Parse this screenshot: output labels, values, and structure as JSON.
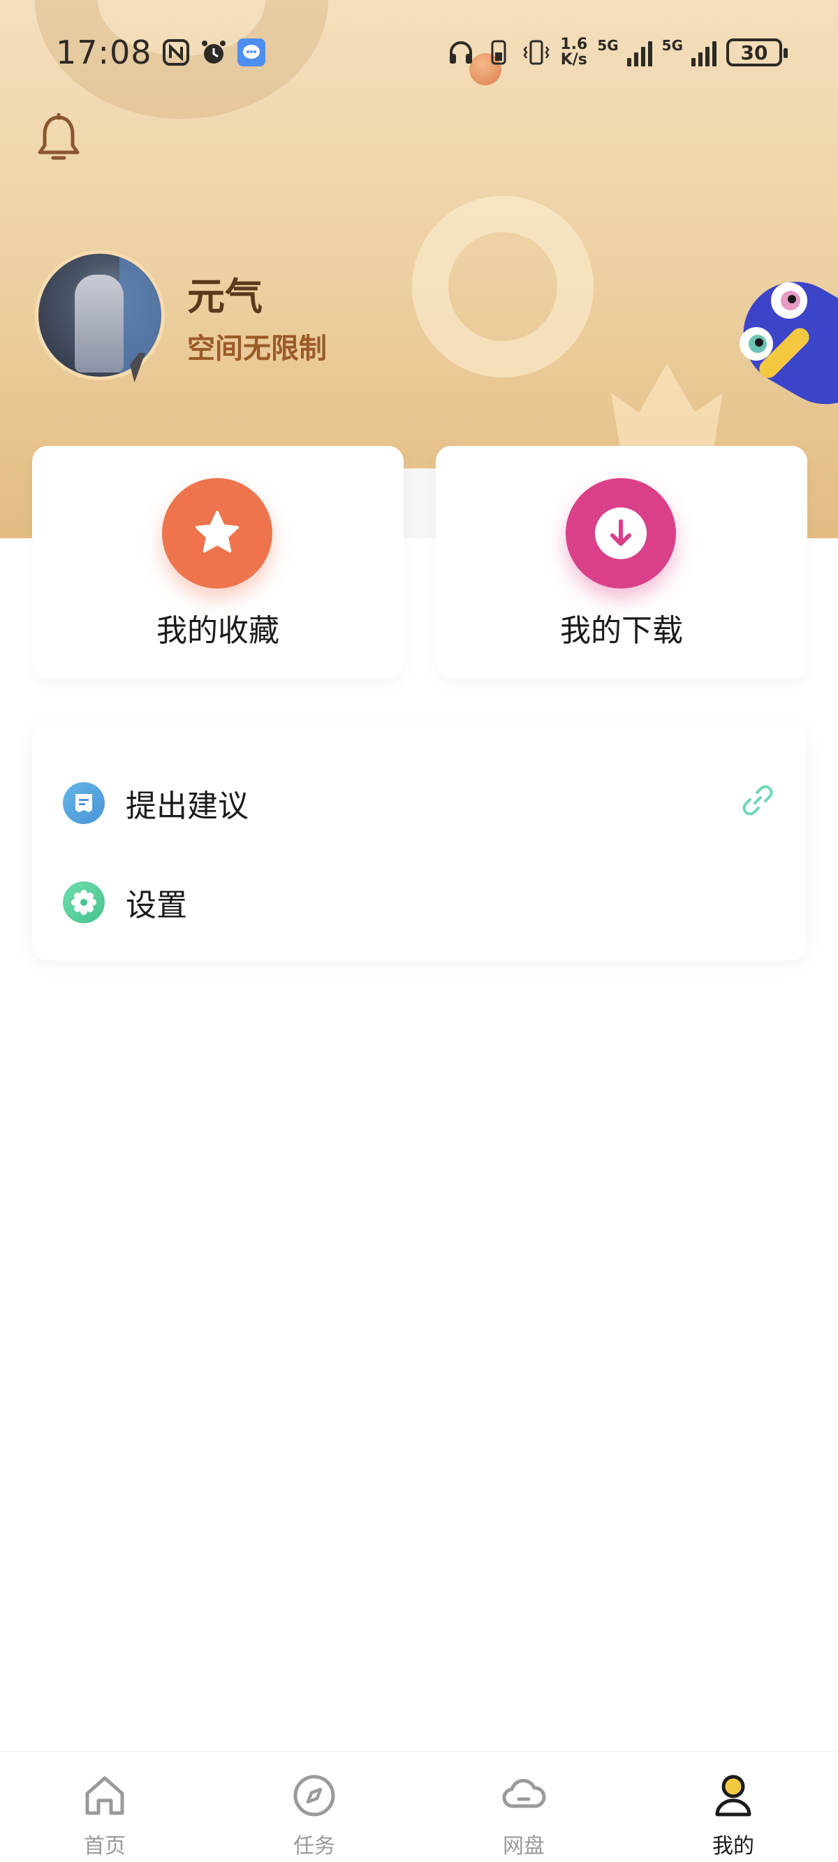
{
  "status_bar": {
    "time": "17:08",
    "net_speed_top": "1.6",
    "net_speed_bottom": "K/s",
    "signal_1": "5G",
    "signal_2": "5G",
    "battery": "30"
  },
  "profile": {
    "name": "元气",
    "subtitle": "空间无限制"
  },
  "cards": {
    "favorites_label": "我的收藏",
    "downloads_label": "我的下载"
  },
  "menu": {
    "items": [
      {
        "label": "提出建议",
        "icon": "feedback-icon"
      },
      {
        "label": "设置",
        "icon": "gear-icon"
      }
    ]
  },
  "bottom_nav": {
    "items": [
      {
        "label": "首页",
        "icon": "home-icon"
      },
      {
        "label": "任务",
        "icon": "compass-icon"
      },
      {
        "label": "网盘",
        "icon": "cloud-icon"
      },
      {
        "label": "我的",
        "icon": "user-icon",
        "active": true
      }
    ]
  },
  "colors": {
    "favorites_accent": "#ed744c",
    "downloads_accent": "#d94088",
    "feedback_accent": "#4a95d6",
    "settings_accent": "#48c48f",
    "name_color": "#5a3a1c",
    "subtitle_color": "#9a5a28"
  }
}
